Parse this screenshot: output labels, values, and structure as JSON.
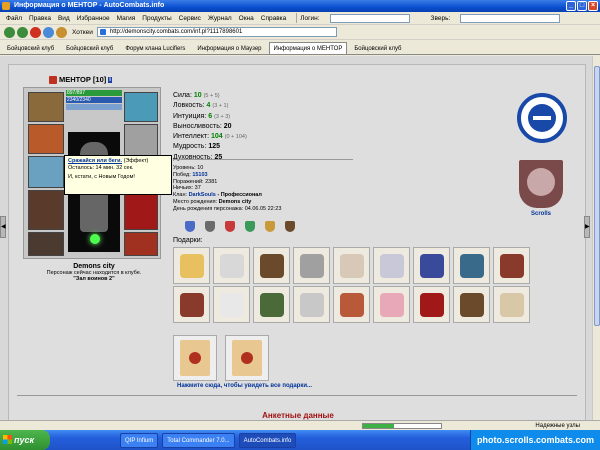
{
  "window": {
    "title": "Информация о МЕНТОР - AutoCombats.info"
  },
  "menu": {
    "items": [
      "Файл",
      "Правка",
      "Вид",
      "Избранное",
      "Магия",
      "Продукты",
      "Сервис",
      "Журнал",
      "Окна",
      "Справка"
    ],
    "login_label": "Логин:",
    "beast_label": "Зверь:"
  },
  "toolbar": {
    "hotkeys_label": "Хоткеи",
    "address": "http://demonscity.combats.com/inf.pl?1117898601"
  },
  "tabs": [
    {
      "label": "Бойцовский клуб"
    },
    {
      "label": "Бойцовский клуб"
    },
    {
      "label": "Форум клана Lucifiers"
    },
    {
      "label": "Информация о Маузер"
    },
    {
      "label": "Информация о МЕНТОР",
      "active": true
    },
    {
      "label": "Бойцовский клуб"
    }
  ],
  "character": {
    "name": "МЕНТОР",
    "level": "[10]",
    "hp": "897/897",
    "mana": "2340/2340"
  },
  "tooltip": {
    "title": "Сражайся или беги.",
    "effect": "(Эффект)",
    "remain": "Осталось: 14 мин. 32 сек.",
    "note": "И, кстати, с Новым Годом!"
  },
  "location": {
    "city": "Demons city",
    "text": "Персонаж сейчас находится в клубе.",
    "club": "\"Зал воинов 2\""
  },
  "stats": [
    {
      "label": "Сила:",
      "value": "10",
      "bonus": "(5 + 5)",
      "green": true
    },
    {
      "label": "Ловкость:",
      "value": "4",
      "bonus": "(3 + 1)",
      "green": true
    },
    {
      "label": "Интуиция:",
      "value": "6",
      "bonus": "(3 + 3)",
      "green": true
    },
    {
      "label": "Выносливость:",
      "value": "20",
      "bonus": "",
      "green": false
    },
    {
      "label": "Интеллект:",
      "value": "104",
      "bonus": "(0 + 104)",
      "green": true
    },
    {
      "label": "Мудрость:",
      "value": "125",
      "bonus": "",
      "green": false
    },
    {
      "label": "Духовность:",
      "value": "25",
      "bonus": "",
      "green": false
    }
  ],
  "info": {
    "level": "Уровень: 10",
    "wins_label": "Побед:",
    "wins": "15103",
    "losses": "Поражений: 2381",
    "draws": "Ничьих: 37",
    "clan_label": "Клан:",
    "clan": "DarkSouls",
    "clan_rank": "- Профессионал",
    "birthplace_label": "Место рождения:",
    "birthplace": "Demons city",
    "birthday": "День рождения персонажа: 04.06.05 22:23"
  },
  "emblem": {
    "label": "Scrolls"
  },
  "gifts": {
    "title": "Подарки:",
    "see_all": "Нажмите сюда, чтобы увидеть все подарки..."
  },
  "anket": {
    "title": "Анкетные данные"
  },
  "status": {
    "safe": "Надежные узлы",
    "progress": 0.4
  },
  "taskbar": {
    "start": "пуск",
    "tasks": [
      "QIP Infium",
      "Total Commander 7.0...",
      "AutoCombats.info"
    ],
    "tray": "photo.scrolls.combats.com"
  },
  "colors": {
    "title": "#0a4fd0",
    "link": "#003399",
    "stat_green": "#008000",
    "anket": "#a01010"
  }
}
